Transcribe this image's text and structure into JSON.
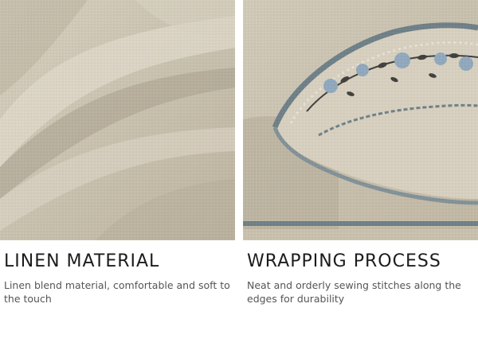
{
  "panels": [
    {
      "title": "LINEN MATERIAL",
      "description": "Linen blend material, comfortable and soft to the touch",
      "image_subject": "linen-fabric-folds"
    },
    {
      "title": "WRAPPING PROCESS",
      "description": "Neat and orderly sewing stitches along the edges for durability",
      "image_subject": "embroidered-hem-edge"
    }
  ],
  "colors": {
    "linen": "#ccc4b3",
    "linen_shadow": "#a69e8d",
    "border_trim": "#6b7d86",
    "floral_blue": "#8ea7bd",
    "floral_dark": "#3b3a38",
    "title_text": "#1c1c1c",
    "caption_text": "#555555"
  }
}
